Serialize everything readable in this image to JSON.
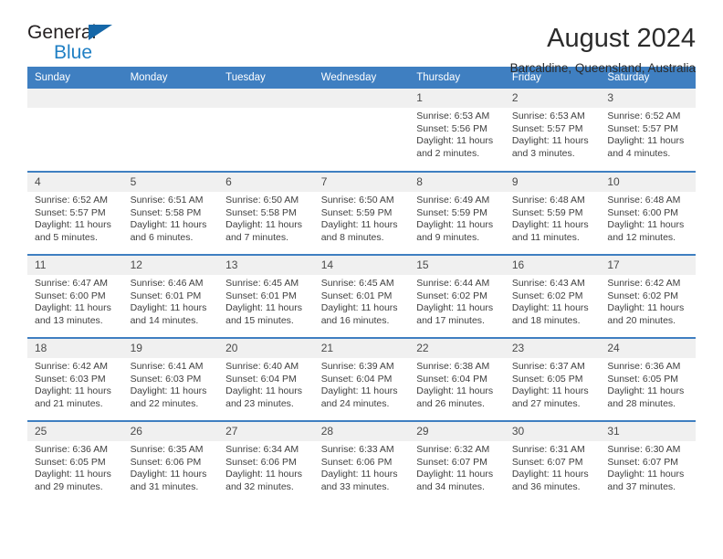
{
  "brand": {
    "line1": "General",
    "line2": "Blue",
    "flag_color": "#1567a8"
  },
  "header": {
    "title": "August 2024",
    "subtitle": "Barcaldine, Queensland, Australia",
    "accent_color": "#3f7fc1"
  },
  "weekdays": [
    "Sunday",
    "Monday",
    "Tuesday",
    "Wednesday",
    "Thursday",
    "Friday",
    "Saturday"
  ],
  "labels": {
    "sunrise": "Sunrise:",
    "sunset": "Sunset:",
    "daylight": "Daylight:"
  },
  "weeks": [
    [
      {
        "day": "",
        "empty": true
      },
      {
        "day": "",
        "empty": true
      },
      {
        "day": "",
        "empty": true
      },
      {
        "day": "",
        "empty": true
      },
      {
        "day": "1",
        "sunrise": "Sunrise: 6:53 AM",
        "sunset": "Sunset: 5:56 PM",
        "daylight": "Daylight: 11 hours and 2 minutes."
      },
      {
        "day": "2",
        "sunrise": "Sunrise: 6:53 AM",
        "sunset": "Sunset: 5:57 PM",
        "daylight": "Daylight: 11 hours and 3 minutes."
      },
      {
        "day": "3",
        "sunrise": "Sunrise: 6:52 AM",
        "sunset": "Sunset: 5:57 PM",
        "daylight": "Daylight: 11 hours and 4 minutes."
      }
    ],
    [
      {
        "day": "4",
        "sunrise": "Sunrise: 6:52 AM",
        "sunset": "Sunset: 5:57 PM",
        "daylight": "Daylight: 11 hours and 5 minutes."
      },
      {
        "day": "5",
        "sunrise": "Sunrise: 6:51 AM",
        "sunset": "Sunset: 5:58 PM",
        "daylight": "Daylight: 11 hours and 6 minutes."
      },
      {
        "day": "6",
        "sunrise": "Sunrise: 6:50 AM",
        "sunset": "Sunset: 5:58 PM",
        "daylight": "Daylight: 11 hours and 7 minutes."
      },
      {
        "day": "7",
        "sunrise": "Sunrise: 6:50 AM",
        "sunset": "Sunset: 5:59 PM",
        "daylight": "Daylight: 11 hours and 8 minutes."
      },
      {
        "day": "8",
        "sunrise": "Sunrise: 6:49 AM",
        "sunset": "Sunset: 5:59 PM",
        "daylight": "Daylight: 11 hours and 9 minutes."
      },
      {
        "day": "9",
        "sunrise": "Sunrise: 6:48 AM",
        "sunset": "Sunset: 5:59 PM",
        "daylight": "Daylight: 11 hours and 11 minutes."
      },
      {
        "day": "10",
        "sunrise": "Sunrise: 6:48 AM",
        "sunset": "Sunset: 6:00 PM",
        "daylight": "Daylight: 11 hours and 12 minutes."
      }
    ],
    [
      {
        "day": "11",
        "sunrise": "Sunrise: 6:47 AM",
        "sunset": "Sunset: 6:00 PM",
        "daylight": "Daylight: 11 hours and 13 minutes."
      },
      {
        "day": "12",
        "sunrise": "Sunrise: 6:46 AM",
        "sunset": "Sunset: 6:01 PM",
        "daylight": "Daylight: 11 hours and 14 minutes."
      },
      {
        "day": "13",
        "sunrise": "Sunrise: 6:45 AM",
        "sunset": "Sunset: 6:01 PM",
        "daylight": "Daylight: 11 hours and 15 minutes."
      },
      {
        "day": "14",
        "sunrise": "Sunrise: 6:45 AM",
        "sunset": "Sunset: 6:01 PM",
        "daylight": "Daylight: 11 hours and 16 minutes."
      },
      {
        "day": "15",
        "sunrise": "Sunrise: 6:44 AM",
        "sunset": "Sunset: 6:02 PM",
        "daylight": "Daylight: 11 hours and 17 minutes."
      },
      {
        "day": "16",
        "sunrise": "Sunrise: 6:43 AM",
        "sunset": "Sunset: 6:02 PM",
        "daylight": "Daylight: 11 hours and 18 minutes."
      },
      {
        "day": "17",
        "sunrise": "Sunrise: 6:42 AM",
        "sunset": "Sunset: 6:02 PM",
        "daylight": "Daylight: 11 hours and 20 minutes."
      }
    ],
    [
      {
        "day": "18",
        "sunrise": "Sunrise: 6:42 AM",
        "sunset": "Sunset: 6:03 PM",
        "daylight": "Daylight: 11 hours and 21 minutes."
      },
      {
        "day": "19",
        "sunrise": "Sunrise: 6:41 AM",
        "sunset": "Sunset: 6:03 PM",
        "daylight": "Daylight: 11 hours and 22 minutes."
      },
      {
        "day": "20",
        "sunrise": "Sunrise: 6:40 AM",
        "sunset": "Sunset: 6:04 PM",
        "daylight": "Daylight: 11 hours and 23 minutes."
      },
      {
        "day": "21",
        "sunrise": "Sunrise: 6:39 AM",
        "sunset": "Sunset: 6:04 PM",
        "daylight": "Daylight: 11 hours and 24 minutes."
      },
      {
        "day": "22",
        "sunrise": "Sunrise: 6:38 AM",
        "sunset": "Sunset: 6:04 PM",
        "daylight": "Daylight: 11 hours and 26 minutes."
      },
      {
        "day": "23",
        "sunrise": "Sunrise: 6:37 AM",
        "sunset": "Sunset: 6:05 PM",
        "daylight": "Daylight: 11 hours and 27 minutes."
      },
      {
        "day": "24",
        "sunrise": "Sunrise: 6:36 AM",
        "sunset": "Sunset: 6:05 PM",
        "daylight": "Daylight: 11 hours and 28 minutes."
      }
    ],
    [
      {
        "day": "25",
        "sunrise": "Sunrise: 6:36 AM",
        "sunset": "Sunset: 6:05 PM",
        "daylight": "Daylight: 11 hours and 29 minutes."
      },
      {
        "day": "26",
        "sunrise": "Sunrise: 6:35 AM",
        "sunset": "Sunset: 6:06 PM",
        "daylight": "Daylight: 11 hours and 31 minutes."
      },
      {
        "day": "27",
        "sunrise": "Sunrise: 6:34 AM",
        "sunset": "Sunset: 6:06 PM",
        "daylight": "Daylight: 11 hours and 32 minutes."
      },
      {
        "day": "28",
        "sunrise": "Sunrise: 6:33 AM",
        "sunset": "Sunset: 6:06 PM",
        "daylight": "Daylight: 11 hours and 33 minutes."
      },
      {
        "day": "29",
        "sunrise": "Sunrise: 6:32 AM",
        "sunset": "Sunset: 6:07 PM",
        "daylight": "Daylight: 11 hours and 34 minutes."
      },
      {
        "day": "30",
        "sunrise": "Sunrise: 6:31 AM",
        "sunset": "Sunset: 6:07 PM",
        "daylight": "Daylight: 11 hours and 36 minutes."
      },
      {
        "day": "31",
        "sunrise": "Sunrise: 6:30 AM",
        "sunset": "Sunset: 6:07 PM",
        "daylight": "Daylight: 11 hours and 37 minutes."
      }
    ]
  ]
}
